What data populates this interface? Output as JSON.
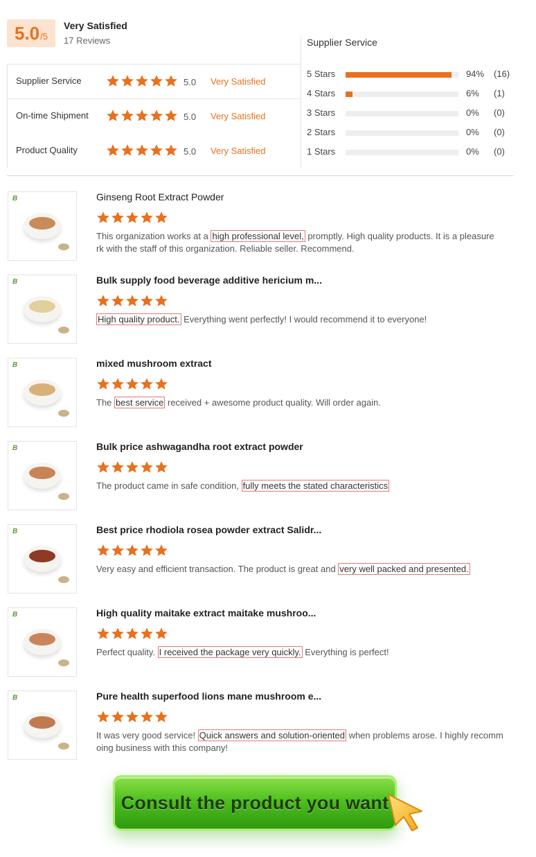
{
  "summary": {
    "score": "5.0",
    "score_max": "/5",
    "overall_label": "Very Satisfied",
    "review_count": "17 Reviews"
  },
  "ratings": [
    {
      "label": "Supplier Service",
      "score": "5.0",
      "text": "Very Satisfied",
      "stars": 5
    },
    {
      "label": "On-time Shipment",
      "score": "5.0",
      "text": "Very Satisfied",
      "stars": 5
    },
    {
      "label": "Product Quality",
      "score": "5.0",
      "text": "Very Satisfied",
      "stars": 5
    }
  ],
  "distribution": {
    "title": "Supplier Service",
    "rows": [
      {
        "label": "5 Stars",
        "percent": "94%",
        "count": "(16)",
        "fraction": 0.94
      },
      {
        "label": "4 Stars",
        "percent": "6%",
        "count": "(1)",
        "fraction": 0.06
      },
      {
        "label": "3 Stars",
        "percent": "0%",
        "count": "(0)",
        "fraction": 0
      },
      {
        "label": "2 Stars",
        "percent": "0%",
        "count": "(0)",
        "fraction": 0
      },
      {
        "label": "1 Stars",
        "percent": "0%",
        "count": "(0)",
        "fraction": 0
      }
    ]
  },
  "reviews": [
    {
      "title": "Ginseng Root Extract Powder",
      "stars": 5,
      "before": "This organization works at a ",
      "highlight": "high professional level,",
      "after": " promptly.  High quality products.  It is a pleasure",
      "line2": "rk with the staff of this organization.  Reliable seller.  Recommend.",
      "powder_color": "#c98a5c"
    },
    {
      "title": "Bulk supply food beverage additive hericium m...",
      "stars": 5,
      "before": "",
      "highlight": "High quality product.",
      "after": " Everything went perfectly!  I would recommend it to everyone!",
      "line2": "",
      "powder_color": "#e2cf9e"
    },
    {
      "title": "mixed mushroom extract",
      "stars": 5,
      "before": "The ",
      "highlight": "best service",
      "after": " received + awesome product quality. Will order again.",
      "line2": "",
      "powder_color": "#d7b07a"
    },
    {
      "title": "Bulk price ashwagandha root extract powder",
      "stars": 5,
      "before": "The product came in safe condition, ",
      "highlight": "fully meets the stated characteristics",
      "after": "",
      "line2": "",
      "powder_color": "#c88456"
    },
    {
      "title": "Best price rhodiola rosea powder extract Salidr...",
      "stars": 5,
      "before": "Very easy and efficient transaction.  The product is great and ",
      "highlight": "very well packed and presented.",
      "after": "",
      "line2": "",
      "powder_color": "#8e3a24"
    },
    {
      "title": "High quality maitake extract maitake mushroo...",
      "stars": 5,
      "before": "Perfect quality. ",
      "highlight": "I received the package very quickly.",
      "after": " Everything is perfect!",
      "line2": "",
      "powder_color": "#c9855a"
    },
    {
      "title": "Pure health superfood lions mane mushroom e...",
      "stars": 5,
      "before": "It was very good service! ",
      "highlight": "Quick answers and solution-oriented",
      "after": " when problems arose. I highly recomm",
      "line2": "oing business with this company!",
      "powder_color": "#c17a4e"
    }
  ],
  "cta": {
    "label": "Consult the product you want"
  },
  "colors": {
    "accent": "#e8711d",
    "highlight_border": "#e07a7a",
    "cta_green": "#4fbf1f"
  }
}
